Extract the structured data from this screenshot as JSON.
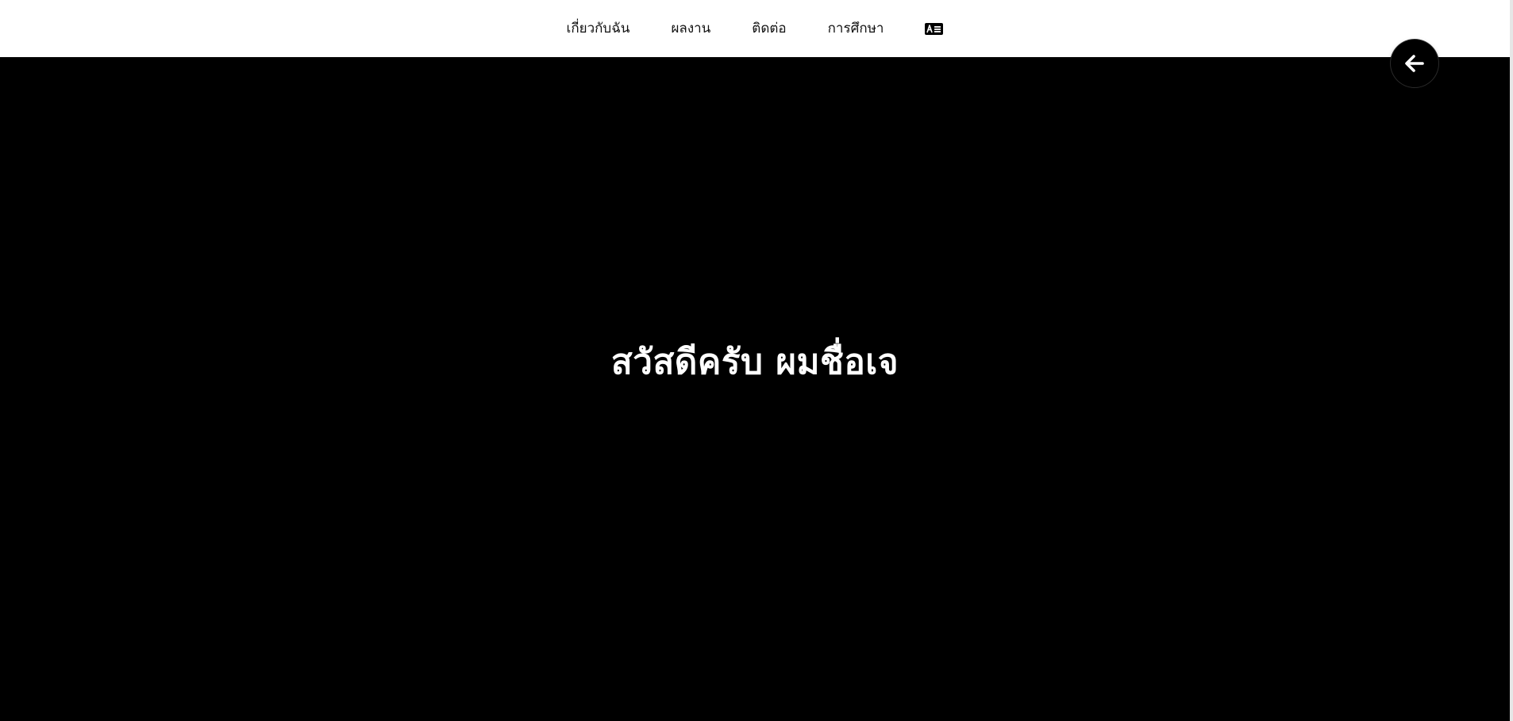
{
  "nav": {
    "items": [
      {
        "label": "เกี่ยวกับฉัน"
      },
      {
        "label": "ผลงาน"
      },
      {
        "label": "ติดต่อ"
      },
      {
        "label": "การศึกษา"
      }
    ],
    "resume_icon": "id-card-icon"
  },
  "hero": {
    "title": "สวัสดีครับ ผมชื่อเจ"
  },
  "back_button": {
    "icon": "arrow-left-icon"
  },
  "colors": {
    "hero_background": "#000000",
    "nav_background": "#ffffff",
    "hero_text": "#ffffff",
    "nav_text": "#111111"
  }
}
